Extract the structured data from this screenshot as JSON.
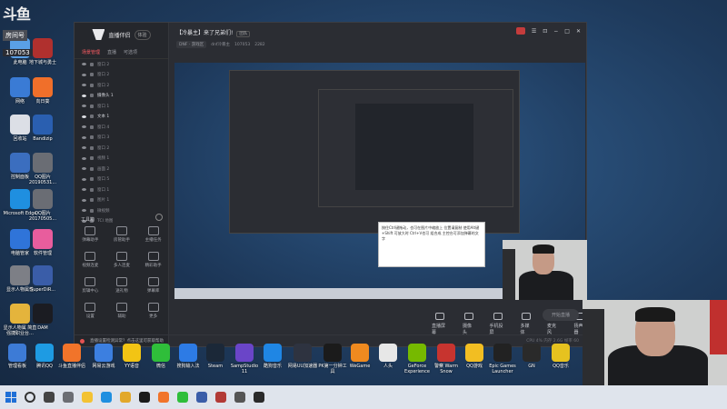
{
  "overlay": {
    "logo_text": "斗鱼",
    "room_label": "房间号",
    "room_number": "107053"
  },
  "desktop_left": [
    {
      "label": "此电脑",
      "color": "#5aa0e6"
    },
    {
      "label": "地下城与勇士",
      "color": "#b0302e"
    },
    {
      "label": "网络",
      "color": "#3a7bd5"
    },
    {
      "label": "向日葵",
      "color": "#f06f2a"
    },
    {
      "label": "回收站",
      "color": "#dcdfe6"
    },
    {
      "label": "Bandizip",
      "color": "#2a5fb0"
    },
    {
      "label": "控制面板",
      "color": "#3b6ebf"
    },
    {
      "label": "QQ图片 20190531...",
      "color": "#6a6d74"
    },
    {
      "label": "Microsoft Edge",
      "color": "#1f8fe0"
    },
    {
      "label": "QQ图片 20170505...",
      "color": "#6a6d74"
    },
    {
      "label": "电脑管家",
      "color": "#2f74d9"
    },
    {
      "label": "软件管理",
      "color": "#e85d9d"
    },
    {
      "label": "显示人物属性",
      "color": "#7d7f86"
    },
    {
      "label": "SuperDiR...",
      "color": "#3a5da8"
    },
    {
      "label": "显示人物属 简直强捷职业台…",
      "color": "#e4b43c"
    },
    {
      "label": "DAM",
      "color": "#1b1c22"
    }
  ],
  "app": {
    "brand": "直播伴侣",
    "beta_tag": "体验",
    "tabs": [
      "场景管理",
      "直播",
      "可选项"
    ],
    "scenes": [
      "窗口 2",
      "窗口 2",
      "窗口 2",
      "摄像头 1",
      "窗口 1",
      "文本 1",
      "窗口 4",
      "窗口 3",
      "窗口 2",
      "视频 1",
      "画面 2",
      "窗口 5",
      "窗口 1",
      "图片 1",
      "微视频",
      "TCI 地图"
    ],
    "toolbox_title": "工具箱",
    "tools": [
      "弹幕助手",
      "房管助手",
      "主播任务",
      "视频连麦",
      "多人连麦",
      "精彩助手",
      "剪辑中心",
      "送礼物",
      "弹幕库",
      "设置",
      "辅助",
      "更多"
    ],
    "room_title": "【冷暴主】来了兄弟们!",
    "room_badge": "团队",
    "category": "DNF · 游戏区",
    "streamer": "dnf冷暴主",
    "room_id": "107053",
    "viewers": "2282",
    "tooltip": "按住Ctrl键拖动，也可在图片中缩放上 位置请复制 使用Alt键+Shift 可放大时 Ctrl+V也可 组合成 主控台可添加弹幕的文字",
    "bottom_actions": [
      "直播屏幕",
      "摄像头",
      "手机投屏",
      "多媒体",
      "麦克风",
      "扬声器"
    ],
    "live_button": "开始直播",
    "status_text": "直播设置检测异常？点击这里可获取帮助",
    "status_meta": "CPU 4%  内存 2.6G  帧率 60",
    "window_ctrls": [
      "☰",
      "⊡",
      "−",
      "□",
      "✕"
    ]
  },
  "dock": [
    {
      "label": "管理看板",
      "color": "#3d7bd6"
    },
    {
      "label": "腾讯QQ",
      "color": "#1e9be3"
    },
    {
      "label": "斗鱼直播伴侣",
      "color": "#f1742a"
    },
    {
      "label": "网易云游戏",
      "color": "#3c7fe0"
    },
    {
      "label": "YY语音",
      "color": "#f2c414"
    },
    {
      "label": "微信",
      "color": "#2fbe3a"
    },
    {
      "label": "搜狗输入法",
      "color": "#2d7be5"
    },
    {
      "label": "Steam",
      "color": "#1b2838"
    },
    {
      "label": "SampStudio 11",
      "color": "#6a45c8"
    },
    {
      "label": "酷狗音乐",
      "color": "#1f86e4"
    },
    {
      "label": "网易UU加速器",
      "color": "#2e3340"
    },
    {
      "label": "PK第一分钟工具",
      "color": "#1b1b1b"
    },
    {
      "label": "WeGame",
      "color": "#ef8a1f"
    },
    {
      "label": "人头",
      "color": "#e7e7e7"
    },
    {
      "label": "GeForce Experience",
      "color": "#76b900"
    },
    {
      "label": "警察 Warm Snow",
      "color": "#c7342f"
    },
    {
      "label": "QQ游戏",
      "color": "#f2be22"
    },
    {
      "label": "Epic Games Launcher",
      "color": "#222222"
    },
    {
      "label": "GN",
      "color": "#2a2a2a"
    },
    {
      "label": "QQ音乐",
      "color": "#e6c21f"
    }
  ],
  "taskbar": [
    "start",
    "search",
    "task-view",
    "explorer",
    "folder",
    "edge",
    "app1",
    "app2",
    "app3",
    "app4",
    "app5",
    "app6",
    "app7",
    "app8"
  ]
}
